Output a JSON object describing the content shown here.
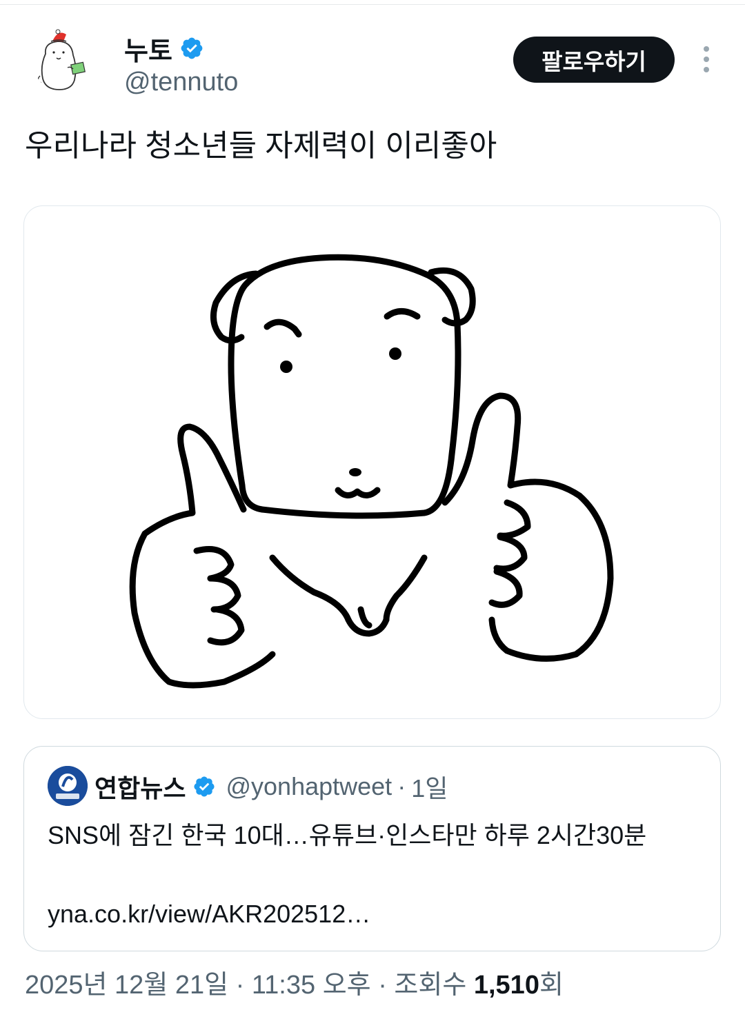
{
  "author": {
    "display_name": "누토",
    "handle": "@tennuto",
    "verified_icon": "verified-badge-icon",
    "avatar_icon": "polar-bear-santa-hat-avatar"
  },
  "actions": {
    "follow_label": "팔로우하기",
    "more_icon": "more-vertical-icon"
  },
  "tweet": {
    "text": "우리나라 청소년들 자제력이 이리좋아",
    "media_icon": "cartoon-dog-thumbs-up-drawing"
  },
  "quote": {
    "display_name": "연합뉴스",
    "handle": "@yonhaptweet",
    "separator": "·",
    "age": "1일",
    "text": "SNS에 잠긴 한국 10대…유튜브·인스타만 하루 2시간30분",
    "url": "yna.co.kr/view/AKR202512…",
    "avatar_icon": "yonhap-news-logo"
  },
  "meta": {
    "date": "2025년 12월 21일",
    "separator": "·",
    "time": "11:35 오후",
    "views_label_prefix": "조회수",
    "views_count": "1,510",
    "views_suffix": "회"
  },
  "colors": {
    "text_primary": "#0f1419",
    "text_secondary": "#536471",
    "verified_blue": "#1d9bf0",
    "follow_button_bg": "#0f1419",
    "border": "#cfd9de"
  }
}
